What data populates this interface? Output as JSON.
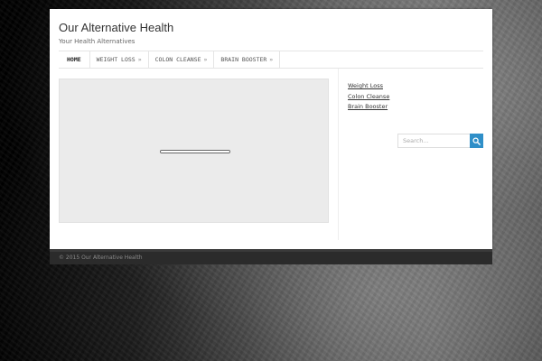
{
  "header": {
    "site_title": "Our Alternative Health",
    "site_description": "Your Health Alternatives"
  },
  "nav": {
    "home": "HOME",
    "items": [
      {
        "label": "WEIGHT LOSS",
        "arrow": "»"
      },
      {
        "label": "COLON CLEANSE",
        "arrow": "»"
      },
      {
        "label": "BRAIN BOOSTER",
        "arrow": "»"
      }
    ]
  },
  "main": {
    "loading_progress": 1.0
  },
  "sidebar": {
    "links": [
      "Weight Loss",
      "Colon Cleanse",
      "Brain Booster"
    ],
    "search_placeholder": "Search..."
  },
  "footer": {
    "copyright": "© 2015 Our Alternative Health"
  },
  "colors": {
    "accent": "#2f8fc8",
    "footer_bg": "#2b2b2b"
  },
  "icons": {
    "search_button": "search-icon"
  }
}
